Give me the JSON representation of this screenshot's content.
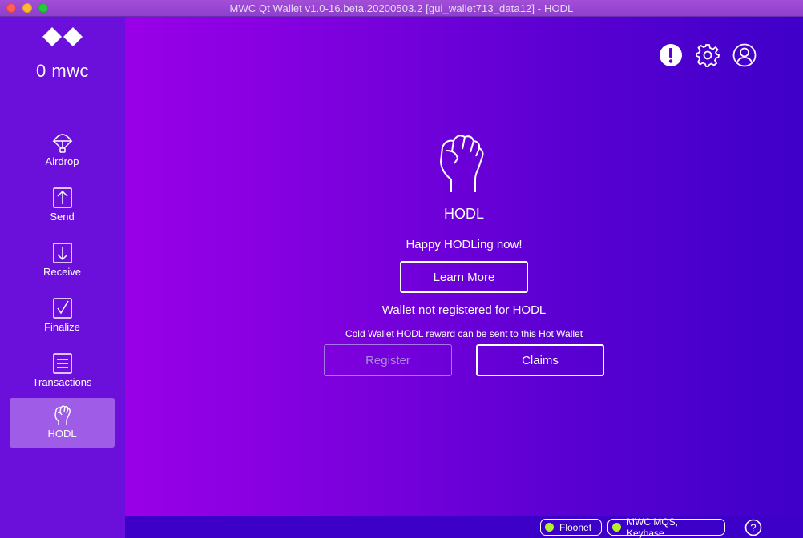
{
  "window": {
    "title": "MWC Qt Wallet v1.0-16.beta.20200503.2 [gui_wallet713_data12] - HODL"
  },
  "sidebar": {
    "balance": "0 mwc",
    "items": [
      {
        "label": "Airdrop",
        "icon": "parachute-icon"
      },
      {
        "label": "Send",
        "icon": "upload-arrow-icon"
      },
      {
        "label": "Receive",
        "icon": "download-arrow-icon"
      },
      {
        "label": "Finalize",
        "icon": "checkmark-icon"
      },
      {
        "label": "Transactions",
        "icon": "list-icon"
      },
      {
        "label": "HODL",
        "icon": "fist-icon",
        "active": true
      }
    ]
  },
  "header": {
    "icons": [
      "alert-icon",
      "gear-icon",
      "account-icon"
    ]
  },
  "main": {
    "title": "HODL",
    "status_message": "Happy HODLing now!",
    "learn_more_label": "Learn More",
    "registration_status": "Wallet not registered for HODL",
    "cold_wallet_note": "Cold Wallet HODL reward can be sent to this Hot Wallet",
    "register_label": "Register",
    "claims_label": "Claims"
  },
  "statusbar": {
    "network_label": "Floonet",
    "listeners_label": "MWC MQS, Keybase",
    "status_color": "#b4f02a",
    "help_label": "?"
  },
  "colors": {
    "sidebar": "#6a10da",
    "active_item": "#9f5ce6",
    "main_gradient_start": "#9a00e8",
    "main_gradient_end": "#3f00c9"
  }
}
